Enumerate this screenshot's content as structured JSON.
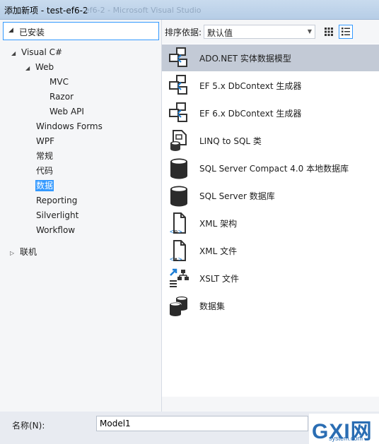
{
  "window": {
    "title": "添加新项 - test-ef6-2",
    "ghost_title": "ef6-2 - Microsoft Visual Studio"
  },
  "left_panel": {
    "installed_label": "已安装",
    "tree": [
      {
        "label": "Visual C#",
        "expander": "◢"
      },
      {
        "label": "Web",
        "expander": "◢"
      },
      {
        "label": "MVC"
      },
      {
        "label": "Razor"
      },
      {
        "label": "Web API"
      },
      {
        "label": "Windows Forms"
      },
      {
        "label": "WPF"
      },
      {
        "label": "常规"
      },
      {
        "label": "代码"
      },
      {
        "label": "数据",
        "selected": true
      },
      {
        "label": "Reporting"
      },
      {
        "label": "Silverlight"
      },
      {
        "label": "Workflow"
      },
      {
        "label": "联机",
        "expander": "▷"
      }
    ]
  },
  "sort": {
    "label": "排序依据:",
    "selected": "默认值"
  },
  "templates": [
    {
      "label": "ADO.NET 实体数据模型",
      "icon": "entity-model-icon",
      "selected": true
    },
    {
      "label": "EF 5.x DbContext 生成器",
      "icon": "dbcontext-generator-icon"
    },
    {
      "label": "EF 6.x DbContext 生成器",
      "icon": "dbcontext-generator-icon"
    },
    {
      "label": "LINQ to SQL 类",
      "icon": "linq-to-sql-icon"
    },
    {
      "label": "SQL Server Compact 4.0 本地数据库",
      "icon": "database-icon"
    },
    {
      "label": "SQL Server 数据库",
      "icon": "database-icon"
    },
    {
      "label": "XML 架构",
      "icon": "xml-schema-icon"
    },
    {
      "label": "XML 文件",
      "icon": "xml-file-icon"
    },
    {
      "label": "XSLT 文件",
      "icon": "xslt-file-icon"
    },
    {
      "label": "数据集",
      "icon": "dataset-icon"
    }
  ],
  "name_field": {
    "label": "名称(N):",
    "value": "Model1"
  },
  "watermark": {
    "brand": "GXI网",
    "site": "system.com"
  }
}
